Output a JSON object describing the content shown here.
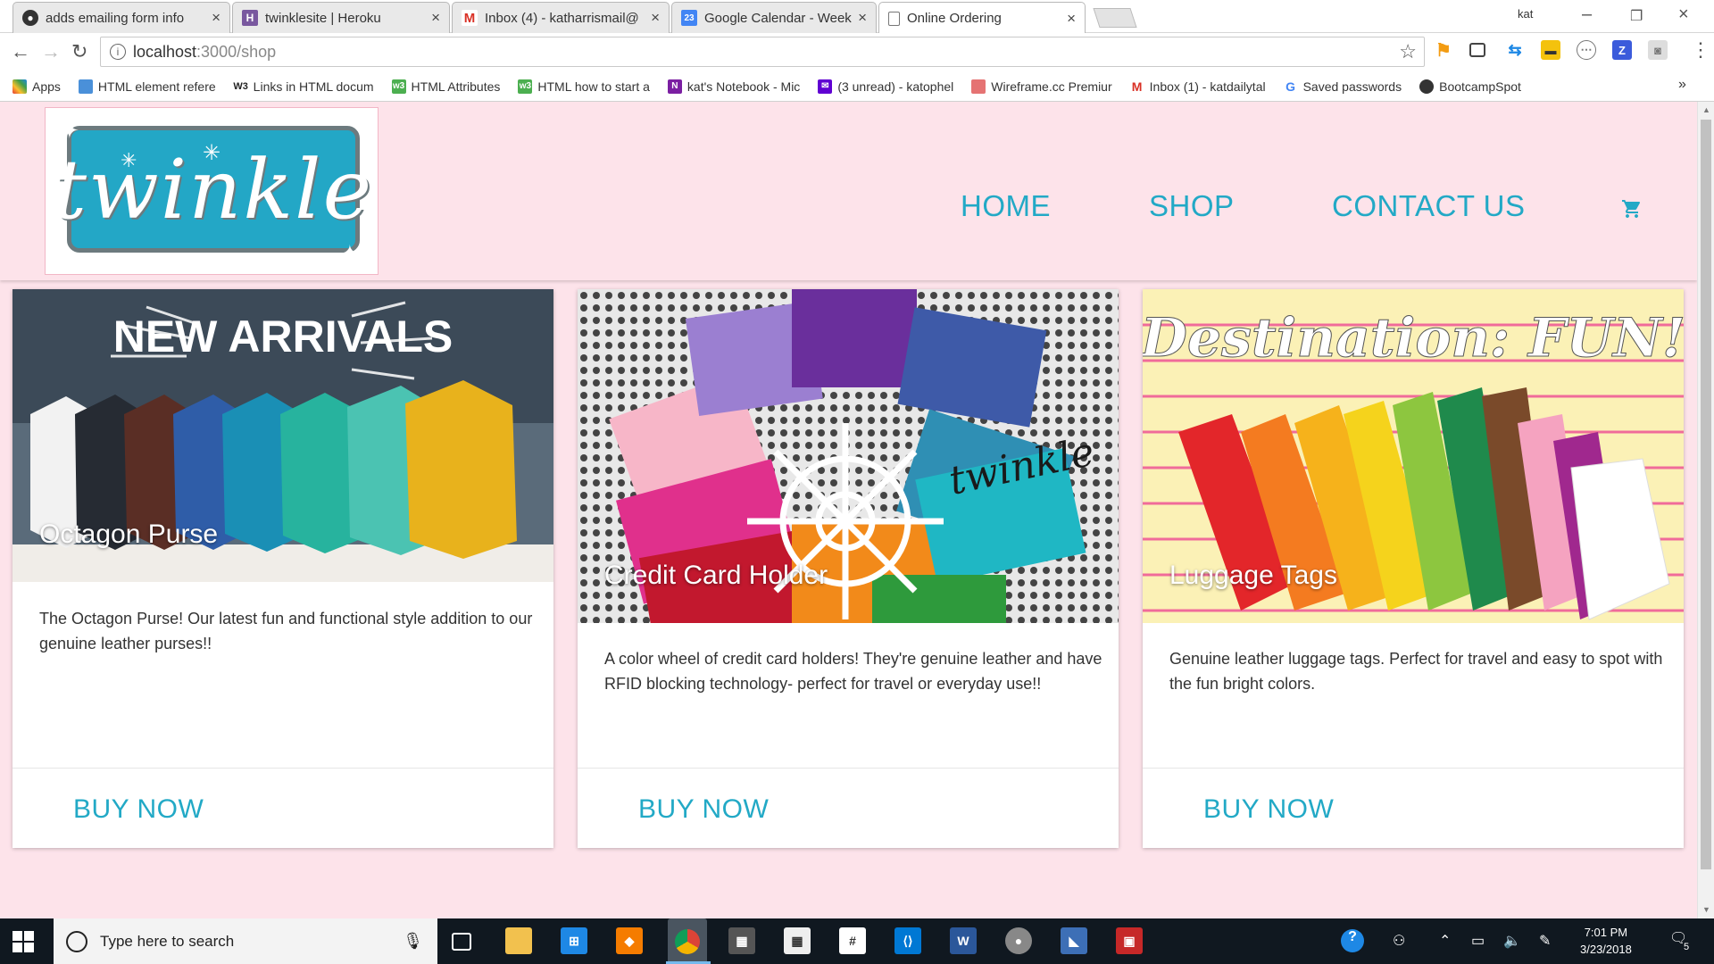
{
  "browser": {
    "tabs": [
      {
        "title": "adds emailing form info",
        "favicon": "github-icon",
        "color": "#333333"
      },
      {
        "title": "twinklesite | Heroku",
        "favicon": "heroku-icon",
        "color": "#79589f"
      },
      {
        "title": "Inbox (4) - katharrismail@",
        "favicon": "gmail-icon",
        "color": "#d93025"
      },
      {
        "title": "Google Calendar - Week",
        "favicon": "calendar-icon",
        "color": "#4285f4"
      },
      {
        "title": "Online Ordering",
        "favicon": "page-icon",
        "color": "#ffffff"
      }
    ],
    "active_tab": 4,
    "profile_name": "kat",
    "url_host": "localhost",
    "url_path": ":3000/shop",
    "bookmarks": [
      {
        "label": "Apps",
        "icon": "apps-icon",
        "color": "#e53935"
      },
      {
        "label": "HTML element refere",
        "icon": "mdn-icon",
        "color": "#4a90d9"
      },
      {
        "label": "Links in HTML docum",
        "icon": "w3-icon",
        "color": "#222222"
      },
      {
        "label": "HTML Attributes",
        "icon": "w3schools-icon",
        "color": "#4caf50"
      },
      {
        "label": "HTML how to start a",
        "icon": "w3schools-icon",
        "color": "#4caf50"
      },
      {
        "label": "kat's Notebook - Mic",
        "icon": "onenote-icon",
        "color": "#7b1fa2"
      },
      {
        "label": "(3 unread) - katophel",
        "icon": "yahoo-mail-icon",
        "color": "#6001d2"
      },
      {
        "label": "Wireframe.cc Premiur",
        "icon": "wireframe-icon",
        "color": "#e57373"
      },
      {
        "label": "Inbox (1) - katdailytal",
        "icon": "gmail-icon",
        "color": "#d93025"
      },
      {
        "label": "Saved passwords",
        "icon": "google-icon",
        "color": "#4285f4"
      },
      {
        "label": "BootcampSpot",
        "icon": "github-icon",
        "color": "#333333"
      }
    ],
    "bookmarks_more": "»"
  },
  "site": {
    "logo_text": "twinkle",
    "nav": [
      {
        "label": "HOME"
      },
      {
        "label": "SHOP"
      },
      {
        "label": "CONTACT US"
      }
    ],
    "accent_color": "#22a9c6",
    "background_color": "#fde3ea"
  },
  "products": [
    {
      "title": "Octagon Purse",
      "description": "The Octagon Purse! Our latest fun and functional style addition to our genuine leather purses!!",
      "button": "BUY NOW",
      "image_caption": "NEW ARRIVALS"
    },
    {
      "title": "Credit Card Holder",
      "description": "A color wheel of credit card holders! They're genuine leather and have RFID blocking technology- perfect for travel or everyday use!!",
      "button": "BUY NOW",
      "image_caption": "twinkle"
    },
    {
      "title": "Luggage Tags",
      "description": "Genuine leather luggage tags. Perfect for travel and easy to spot with the fun bright colors.",
      "button": "BUY NOW",
      "image_caption": "Destination: FUN!"
    }
  ],
  "taskbar": {
    "search_placeholder": "Type here to search",
    "time": "7:01 PM",
    "date": "3/23/2018",
    "notifications": "5"
  }
}
